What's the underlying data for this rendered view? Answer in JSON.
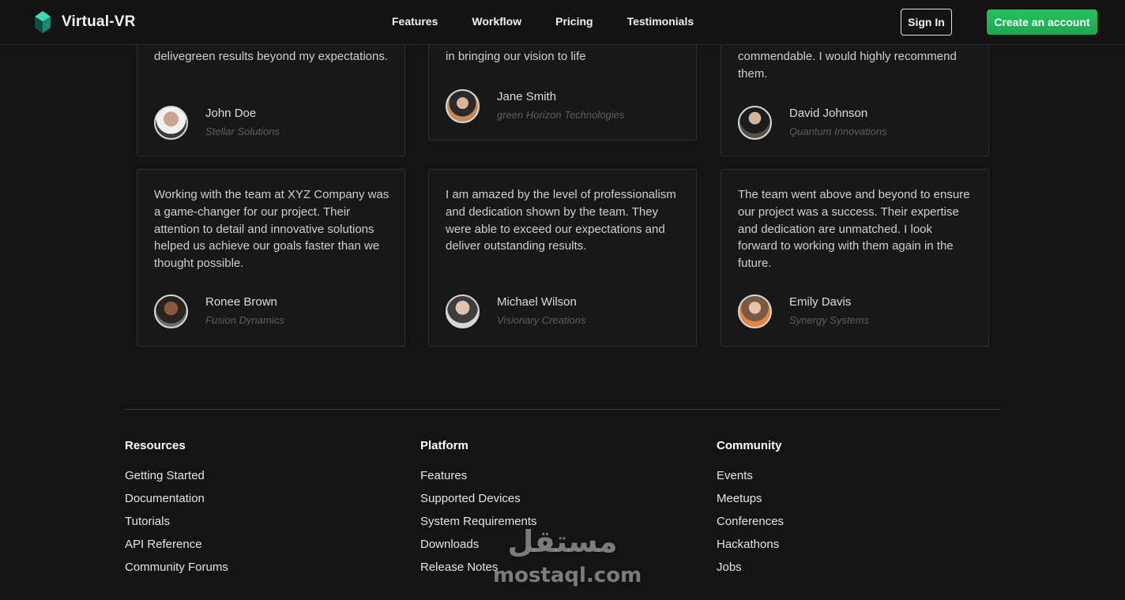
{
  "brand": {
    "name": "Virtual-VR",
    "accent_color": "#22c55e"
  },
  "nav": {
    "links": [
      "Features",
      "Workflow",
      "Pricing",
      "Testimonials"
    ],
    "sign_in": "Sign In",
    "create_account": "Create an account"
  },
  "testimonials": [
    {
      "text": "delivegreen results beyond my expectations.",
      "name": "John Doe",
      "company": "Stellar Solutions",
      "avatar_icon": "person-photo"
    },
    {
      "text": "in bringing our vision to life",
      "name": "Jane Smith",
      "company": "green Horizon Technologies",
      "avatar_icon": "person-photo"
    },
    {
      "text": "commendable. I would highly recommend them.",
      "name": "David Johnson",
      "company": "Quantum Innovations",
      "avatar_icon": "person-photo"
    },
    {
      "text": "Working with the team at XYZ Company was a game-changer for our project. Their attention to detail and innovative solutions helped us achieve our goals faster than we thought possible.",
      "name": "Ronee Brown",
      "company": "Fusion Dynamics",
      "avatar_icon": "person-photo"
    },
    {
      "text": "I am amazed by the level of professionalism and dedication shown by the team. They were able to exceed our expectations and deliver outstanding results.",
      "name": "Michael Wilson",
      "company": "Visionary Creations",
      "avatar_icon": "person-photo"
    },
    {
      "text": "The team went above and beyond to ensure our project was a success. Their expertise and dedication are unmatched. I look forward to working with them again in the future.",
      "name": "Emily Davis",
      "company": "Synergy Systems",
      "avatar_icon": "person-photo"
    }
  ],
  "footer": {
    "columns": [
      {
        "heading": "Resources",
        "links": [
          "Getting Started",
          "Documentation",
          "Tutorials",
          "API Reference",
          "Community Forums"
        ]
      },
      {
        "heading": "Platform",
        "links": [
          "Features",
          "Supported Devices",
          "System Requirements",
          "Downloads",
          "Release Notes"
        ]
      },
      {
        "heading": "Community",
        "links": [
          "Events",
          "Meetups",
          "Conferences",
          "Hackathons",
          "Jobs"
        ]
      }
    ]
  },
  "watermark": {
    "arabic": "مستقل",
    "latin": "mostaql.com"
  }
}
